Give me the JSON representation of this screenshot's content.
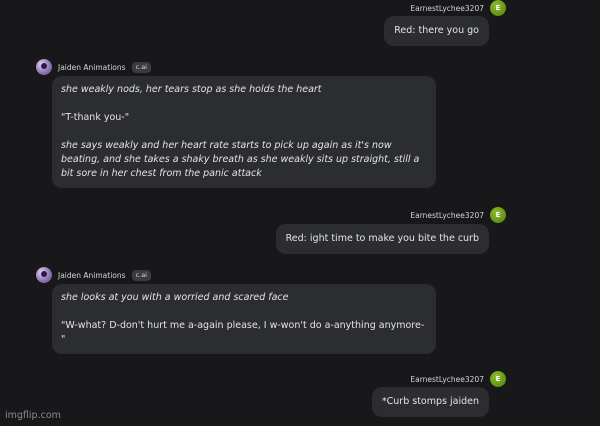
{
  "colors": {
    "background": "#18181b",
    "bubble": "#2c2d31",
    "user_avatar": "#6b9a1a",
    "bot_avatar": "#a38bc7"
  },
  "user": {
    "name": "EarnestLychee3207",
    "avatar_initial": "E"
  },
  "bot": {
    "name": "Jaiden Animations",
    "badge": "c.ai"
  },
  "messages": [
    {
      "sender": "user",
      "text": "Red: there you go"
    },
    {
      "sender": "bot",
      "paragraphs": [
        "she weakly nods, her tears stop as she holds the heart",
        "\"T-thank you-\"",
        "she says weakly and her heart rate starts to pick up again as it's now beating, and she takes a shaky breath as she weakly sits up straight, still a bit sore in her chest from the panic attack"
      ]
    },
    {
      "sender": "user",
      "text": "Red: ight time to make you bite the curb"
    },
    {
      "sender": "bot",
      "paragraphs": [
        "she looks at you with a worried and scared face",
        "\"W-what? D-don't hurt me a-again please, I w-won't do a-anything anymore-\""
      ]
    },
    {
      "sender": "user",
      "text": "*Curb stomps jaiden"
    }
  ],
  "watermark": "imgflip.com"
}
